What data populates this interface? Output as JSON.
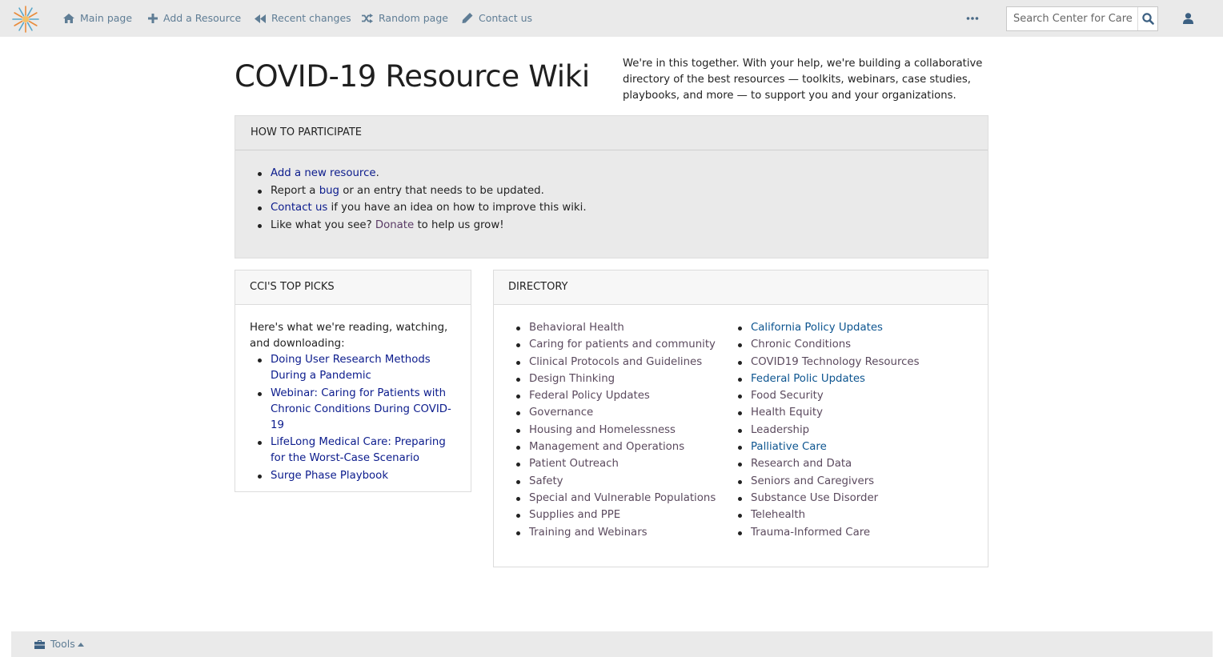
{
  "nav": {
    "items": [
      {
        "label": "Main page",
        "icon": "home-icon"
      },
      {
        "label": "Add a Resource",
        "icon": "plus-icon"
      },
      {
        "label": "Recent changes",
        "icon": "backward-icon"
      },
      {
        "label": "Random page",
        "icon": "shuffle-icon"
      },
      {
        "label": "Contact us",
        "icon": "pencil-icon"
      }
    ],
    "search_placeholder": "Search Center for Care"
  },
  "header": {
    "title": "COVID-19 Resource Wiki",
    "intro": "We're in this together. With your help, we're building a collaborative directory of the best resources — toolkits, webinars, case studies, playbooks, and more — to support you and your organizations."
  },
  "participate": {
    "title": "HOW TO PARTICIPATE",
    "items": [
      {
        "link": "Add a new resource",
        "after": "."
      },
      {
        "before": "Report a ",
        "link": "bug",
        "after": " or an entry that needs to be updated."
      },
      {
        "link": "Contact us",
        "after": " if you have an idea on how to improve this wiki."
      },
      {
        "before": "Like what you see? ",
        "link": "Donate",
        "after": " to help us grow!"
      }
    ]
  },
  "top_picks": {
    "title": "CCI'S TOP PICKS",
    "intro": "Here's what we're reading, watching, and downloading:",
    "items": [
      "Doing User Research Methods During a Pandemic",
      "Webinar: Caring for Patients with Chronic Conditions During COVID-19",
      "LifeLong Medical Care: Preparing for the Worst-Case Scenario",
      "Surge Phase Playbook"
    ]
  },
  "directory": {
    "title": "DIRECTORY",
    "col1": [
      "Behavioral Health",
      "Caring for patients and community",
      "Clinical Protocols and Guidelines",
      "Design Thinking",
      "Federal Policy Updates",
      "Governance",
      "Housing and Homelessness",
      "Management and Operations",
      "Patient Outreach",
      "Safety",
      "Special and Vulnerable Populations",
      "Supplies and PPE",
      "Training and Webinars"
    ],
    "col2": [
      "California Policy Updates",
      "Chronic Conditions",
      "COVID19 Technology Resources",
      "Federal Polic Updates",
      "Food Security",
      "Health Equity",
      "Leadership",
      "Palliative Care",
      "Research and Data",
      "Seniors and Caregivers",
      "Substance Use Disorder",
      "Telehealth",
      "Trauma-Informed Care"
    ]
  },
  "footer": {
    "tools_label": "Tools"
  },
  "colors": {
    "nav_bg": "#eaeaea",
    "nav_link": "#5f7d95",
    "link_navy": "#0b1b8c",
    "link_blue": "#0d5590",
    "link_muted": "#5b4a5e"
  }
}
